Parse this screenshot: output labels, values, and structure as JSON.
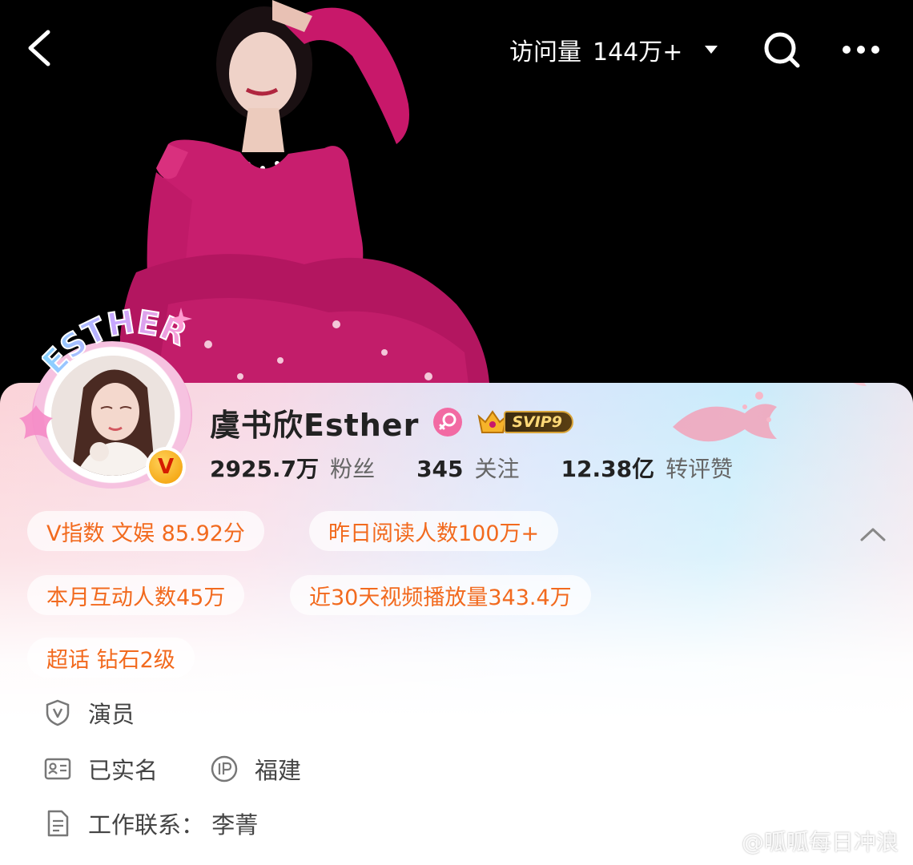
{
  "header": {
    "visits_label": "访问量",
    "visits_value": "144万+"
  },
  "profile": {
    "avatar_frame_text": "ESTHER",
    "name": "虞书欣Esther",
    "svip_label": "SVIP9",
    "verified_badge": "V",
    "stats": [
      {
        "value": "2925.7万",
        "label": "粉丝"
      },
      {
        "value": "345",
        "label": "关注"
      },
      {
        "value": "12.38亿",
        "label": "转评赞"
      }
    ]
  },
  "chips": [
    "V指数 文娱 85.92分",
    "昨日阅读人数100万+",
    "本月互动人数45万",
    "近30天视频播放量343.4万",
    "超话 钻石2级"
  ],
  "info": {
    "occupation": "演员",
    "real_name": "已实名",
    "ip_location": "福建",
    "work_contact": "工作联系：  李菁"
  },
  "watermark": "@呱呱每日冲浪",
  "icons": {
    "back": "chevron-left-icon",
    "dropdown": "caret-down-icon",
    "search": "search-icon",
    "more": "more-dots-icon",
    "gender": "female-icon",
    "collapse": "chevron-up-icon",
    "occupation": "shield-v-icon",
    "real_name": "id-card-icon",
    "ip": "ip-icon",
    "contact": "document-icon"
  },
  "colors": {
    "accent_orange": "#f26a1e",
    "dress_pink": "#c81e6e",
    "gender_pink": "#f26aa3",
    "svip_gold": "#ffd977"
  }
}
